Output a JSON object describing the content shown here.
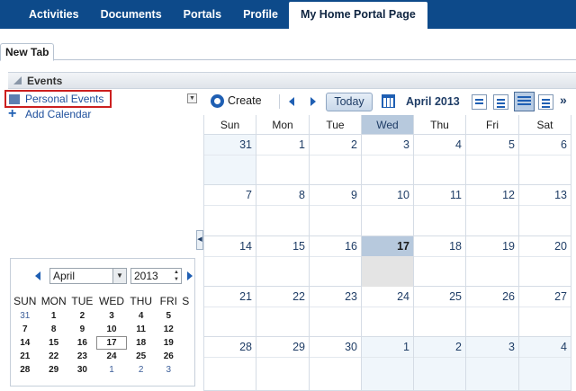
{
  "topnav": {
    "tabs": [
      "Activities",
      "Documents",
      "Portals",
      "Profile",
      "My Home Portal Page"
    ],
    "active_index": 4
  },
  "page_tabs": {
    "label": "New Tab"
  },
  "events_portlet": {
    "title": "Events"
  },
  "calendars": {
    "items": [
      {
        "label": "Personal Events",
        "color": "#5d7fb1"
      }
    ],
    "add_label": "Add Calendar"
  },
  "mini_calendar": {
    "month": "April",
    "year": "2013",
    "day_headers": [
      "SUN",
      "MON",
      "TUE",
      "WED",
      "THU",
      "FRI",
      "S"
    ],
    "weeks": [
      [
        "31",
        "1",
        "2",
        "3",
        "4",
        "5"
      ],
      [
        "7",
        "8",
        "9",
        "10",
        "11",
        "12"
      ],
      [
        "14",
        "15",
        "16",
        "17",
        "18",
        "19"
      ],
      [
        "21",
        "22",
        "23",
        "24",
        "25",
        "26"
      ],
      [
        "28",
        "29",
        "30",
        "1",
        "2",
        "3"
      ]
    ],
    "today": "17"
  },
  "toolbar": {
    "create_label": "Create",
    "today_label": "Today",
    "month_title": "April 2013",
    "more": "»"
  },
  "month_grid": {
    "day_headers": [
      "Sun",
      "Mon",
      "Tue",
      "Wed",
      "Thu",
      "Fri",
      "Sat"
    ],
    "current_weekday": "Wed",
    "weeks": [
      [
        "31",
        "1",
        "2",
        "3",
        "4",
        "5",
        "6"
      ],
      [
        "7",
        "8",
        "9",
        "10",
        "11",
        "12",
        "13"
      ],
      [
        "14",
        "15",
        "16",
        "17",
        "18",
        "19",
        "20"
      ],
      [
        "21",
        "22",
        "23",
        "24",
        "25",
        "26",
        "27"
      ],
      [
        "28",
        "29",
        "30",
        "1",
        "2",
        "3",
        "4"
      ]
    ],
    "today": "17"
  },
  "colors": {
    "nav": "#0d4a8a",
    "accent": "#1f5fb3",
    "highlight": "#b7c9dd",
    "outside_month": "#f0f6fb"
  }
}
